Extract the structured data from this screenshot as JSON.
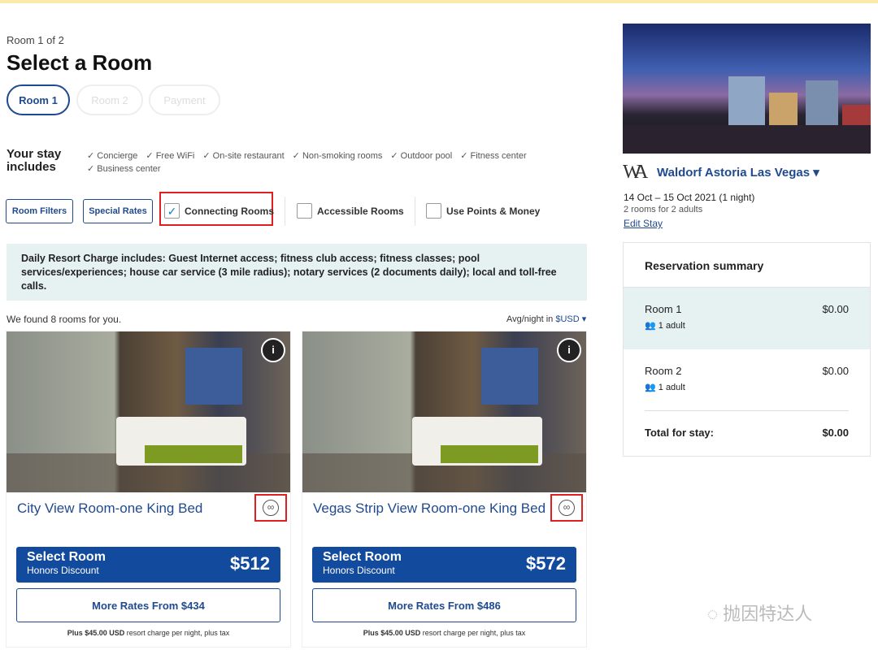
{
  "header": {
    "step": "Room 1 of 2",
    "title": "Select a Room",
    "steps": [
      {
        "label": "Room 1",
        "active": true
      },
      {
        "label": "Room 2",
        "active": false
      },
      {
        "label": "Payment",
        "active": false
      }
    ]
  },
  "stay": {
    "heading": "Your stay includes",
    "amenities": [
      "✓ Concierge",
      "✓ Free WiFi",
      "✓ On-site restaurant",
      "✓ Non-smoking rooms",
      "✓ Outdoor pool",
      "✓ Fitness center",
      "✓ Business center"
    ]
  },
  "filters": {
    "room_filters": "Room Filters",
    "special_rates": "Special Rates",
    "checkboxes": [
      {
        "label": "Connecting Rooms",
        "checked": true
      },
      {
        "label": "Accessible Rooms",
        "checked": false
      },
      {
        "label": "Use Points & Money",
        "checked": false
      }
    ]
  },
  "notice": "Daily Resort Charge includes: Guest Internet access; fitness club access; fitness classes; pool services/experiences; house car service (3 mile radius); notary services (2 documents daily); local and toll-free calls.",
  "results": {
    "found": "We found 8 rooms for you.",
    "avg_label": "Avg/night in",
    "currency": "$USD ▾"
  },
  "rooms": [
    {
      "name": "City View Room-one King Bed",
      "select": "Select Room",
      "rate": "Honors Discount",
      "price": "$512",
      "more": "More Rates From $434",
      "plus_bold": "Plus $45.00 USD",
      "plus_rest": " resort charge per night, plus tax",
      "info": "i"
    },
    {
      "name": "Vegas Strip View Room-one King Bed",
      "select": "Select Room",
      "rate": "Honors Discount",
      "price": "$572",
      "more": "More Rates From $486",
      "plus_bold": "Plus $45.00 USD",
      "plus_rest": " resort charge per night, plus tax",
      "info": "i"
    }
  ],
  "hotel": {
    "logo": "WA",
    "name": "Waldorf Astoria Las Vegas ▾",
    "dates": "14 Oct – 15 Oct 2021 (1 night)",
    "guests": "2 rooms for 2 adults",
    "edit": "Edit Stay"
  },
  "summary": {
    "title": "Reservation summary",
    "rows": [
      {
        "room": "Room 1",
        "amount": "$0.00",
        "adults": "1 adult"
      },
      {
        "room": "Room 2",
        "amount": "$0.00",
        "adults": "1 adult"
      }
    ],
    "total_label": "Total for stay:",
    "total": "$0.00"
  },
  "watermark": "抛因特达人",
  "colors": {
    "brand": "#124b9e",
    "highlight": "#e6f1f2",
    "annotation": "#e02020"
  }
}
